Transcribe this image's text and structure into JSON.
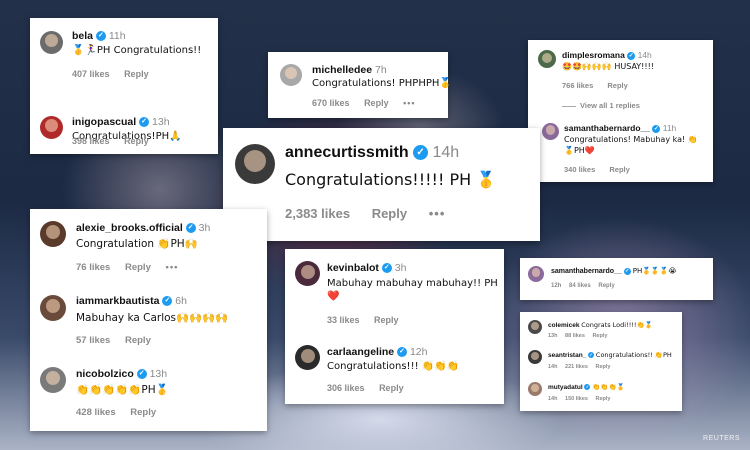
{
  "background": {
    "credit": "REUTERS"
  },
  "cards": {
    "bela_card": {
      "comments": [
        {
          "user": "bela",
          "time": "11h",
          "text": "🥇🏃‍♀️PH Congratulations!!",
          "likes": "407 likes",
          "reply": "Reply",
          "avatar_color": "#6b6b6b"
        },
        {
          "user": "inigopascual",
          "time": "13h",
          "text": "Congratulations!PH🙏",
          "likes": "398 likes",
          "reply": "Reply",
          "avatar_color": "#b02a2a"
        }
      ]
    },
    "michelle_card": {
      "comments": [
        {
          "user": "michelledee",
          "time": "7h",
          "text": "Congratulations! PHPHPH🥇",
          "likes": "670 likes",
          "reply": "Reply",
          "more": "•••",
          "avatar_color": "#a8a8a8"
        }
      ]
    },
    "dimples_card": {
      "comments": [
        {
          "user": "dimplesromana",
          "time": "14h",
          "text": "🤩🤩🙌🙌🙌 HUSAY!!!!",
          "likes": "766 likes",
          "reply": "Reply",
          "view_replies": "View all 1 replies",
          "avatar_color": "#4a6a4a"
        },
        {
          "user": "samanthabernardo__",
          "time": "11h",
          "text": "Congratulations! Mabuhay ka! 👏",
          "text2": "🥇PH❤️",
          "likes": "340 likes",
          "reply": "Reply",
          "avatar_color": "#8a6a9a"
        }
      ]
    },
    "anne_card": {
      "comments": [
        {
          "user": "annecurtissmith",
          "time": "14h",
          "text": "Congratulations!!!!! PH 🥇",
          "likes": "2,383 likes",
          "reply": "Reply",
          "more": "•••",
          "avatar_color": "#3a3a3a"
        }
      ]
    },
    "alexie_card": {
      "comments": [
        {
          "user": "alexie_brooks.official",
          "time": "3h",
          "text": "Congratulation 👏PH🙌",
          "likes": "76 likes",
          "reply": "Reply",
          "more": "•••",
          "avatar_color": "#5a3a2a"
        },
        {
          "user": "iammarkbautista",
          "time": "6h",
          "text": "Mabuhay ka Carlos🙌🙌🙌🙌",
          "likes": "57 likes",
          "reply": "Reply",
          "avatar_color": "#6a4a3a"
        },
        {
          "user": "nicobolzico",
          "time": "13h",
          "text": "👏👏👏👏👏PH🥇",
          "likes": "428 likes",
          "reply": "Reply",
          "avatar_color": "#7a7a7a"
        }
      ]
    },
    "kevin_card": {
      "comments": [
        {
          "user": "kevinbalot",
          "time": "3h",
          "text": "Mabuhay mabuhay mabuhay!! PH",
          "text2": "❤️",
          "likes": "33 likes",
          "reply": "Reply",
          "avatar_color": "#4a2a3a"
        },
        {
          "user": "carlaangeline",
          "time": "12h",
          "text": "Congratulations!!! 👏👏👏",
          "likes": "306 likes",
          "reply": "Reply",
          "avatar_color": "#2a2a2a"
        }
      ]
    },
    "samantha_small_card": {
      "comments": [
        {
          "user": "samanthabernardo__",
          "time": "",
          "text": "PH🥇🥇🥇😭",
          "likes": "84 likes",
          "meta_time": "12h",
          "reply": "Reply",
          "avatar_color": "#8a6a9a"
        }
      ]
    },
    "cole_card": {
      "comments": [
        {
          "user": "colemicek",
          "time": "",
          "text": "Congrats Lodi!!!!👏🥇",
          "likes": "88 likes",
          "meta_time": "13h",
          "reply": "Reply",
          "avatar_color": "#4a4a4a"
        },
        {
          "user": "seantristan_",
          "time": "",
          "text": "Congratulations!! 👏PH",
          "likes": "221 likes",
          "meta_time": "14h",
          "reply": "Reply",
          "avatar_color": "#3a3a3a"
        },
        {
          "user": "mutyadatul",
          "time": "",
          "text": "👏👏👏🥇",
          "likes": "150 likes",
          "meta_time": "14h",
          "reply": "Reply",
          "avatar_color": "#9a7a6a"
        }
      ]
    }
  }
}
